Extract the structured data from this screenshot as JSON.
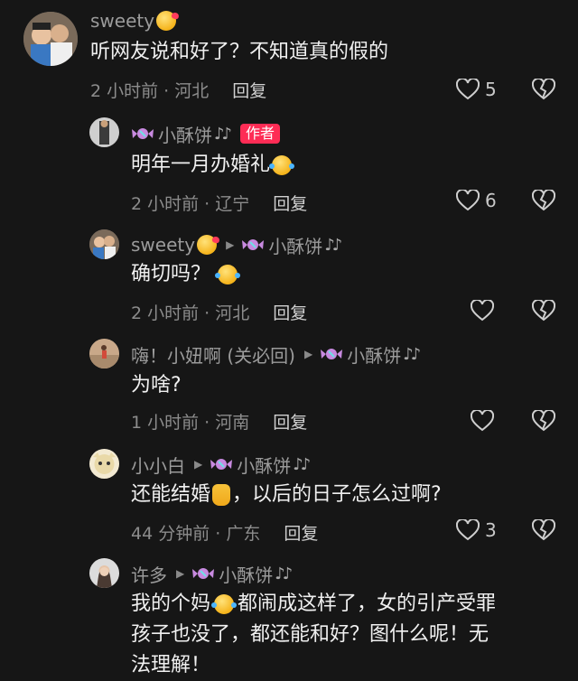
{
  "comments": [
    {
      "name": "sweety",
      "text": "听网友说和好了？不知道真的假的",
      "meta": "2 小时前 · 河北",
      "reply": "回复",
      "likes": "5"
    },
    {
      "name": "小酥饼",
      "author_tag": "作者",
      "text": "明年一月办婚礼",
      "meta": "2 小时前 · 辽宁",
      "reply": "回复",
      "likes": "6"
    },
    {
      "name": "sweety",
      "reply_to": "小酥饼",
      "text": "确切吗？",
      "meta": "2 小时前 · 河北",
      "reply": "回复",
      "likes": ""
    },
    {
      "name": "嗨！小妞啊 (关必回)",
      "reply_to": "小酥饼",
      "text": "为啥?",
      "meta": "1 小时前 · 河南",
      "reply": "回复",
      "likes": ""
    },
    {
      "name": "小小白",
      "reply_to": "小酥饼",
      "text_before": "还能结婚",
      "text_after": "，以后的日子怎么过啊?",
      "meta": "44 分钟前 · 广东",
      "reply": "回复",
      "likes": "3"
    },
    {
      "name": "许多",
      "reply_to": "小酥饼",
      "text_before": "我的个妈",
      "text_after": "都闹成这样了，女的引产受罪",
      "text_line2": "孩子也没了，都还能和好？图什么呢！无",
      "text_line3": "法理解！"
    }
  ],
  "icons": {
    "like": "heart-outline-icon",
    "dislike": "broken-heart-icon",
    "candy": "candy-icon",
    "notes": "music-notes-icon"
  },
  "colors": {
    "background": "#161616",
    "author_tag": "#fe2c55",
    "secondary_text": "#8c8c8c"
  }
}
